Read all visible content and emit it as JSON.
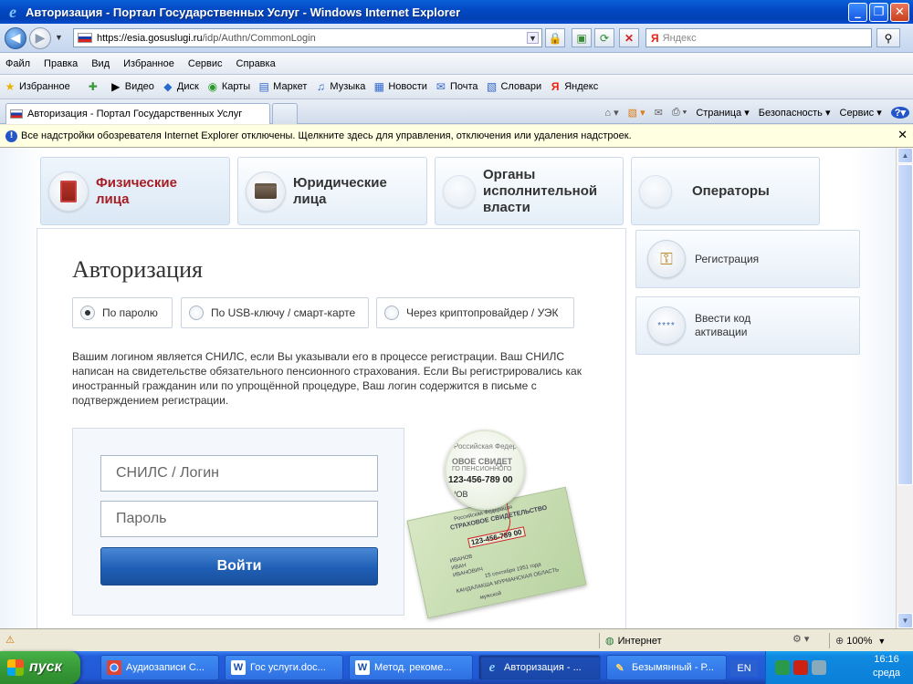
{
  "window": {
    "title": "Авторизация - Портал Государственных Услуг - Windows Internet Explorer",
    "ie_glyph": "e"
  },
  "navigation": {
    "url_scheme": "https://",
    "url_host": "esia.gosuslugi.ru",
    "url_path": "/idp/Authn/CommonLogin",
    "search_placeholder": "Яндекс",
    "search_brand": "Я"
  },
  "menu": [
    "Файл",
    "Правка",
    "Вид",
    "Избранное",
    "Сервис",
    "Справка"
  ],
  "favorites": [
    {
      "icon": "star-icon",
      "label": "Избранное",
      "glyph": "★"
    },
    {
      "icon": "add-favorite-icon",
      "label": "",
      "glyph": "✚"
    },
    {
      "icon": "video-icon",
      "label": "Видео",
      "glyph": "▶"
    },
    {
      "icon": "disk-icon",
      "label": "Диск",
      "glyph": "◆"
    },
    {
      "icon": "maps-icon",
      "label": "Карты",
      "glyph": "◉"
    },
    {
      "icon": "market-icon",
      "label": "Маркет",
      "glyph": "▤"
    },
    {
      "icon": "music-icon",
      "label": "Музыка",
      "glyph": "♫"
    },
    {
      "icon": "news-icon",
      "label": "Новости",
      "glyph": "▦"
    },
    {
      "icon": "mail-icon",
      "label": "Почта",
      "glyph": "✉"
    },
    {
      "icon": "dictionary-icon",
      "label": "Словари",
      "glyph": "▧"
    },
    {
      "icon": "yandex-icon",
      "label": "Яндекс",
      "glyph": "Я"
    }
  ],
  "tab": {
    "title": "Авторизация - Портал Государственных Услуг"
  },
  "commands": {
    "page": "Страница ▾",
    "security": "Безопасность ▾",
    "service": "Сервис ▾",
    "help": "?▾"
  },
  "infobar": {
    "text": "Все надстройки обозревателя Internet Explorer отключены. Щелкните здесь для управления, отключения или удаления надстроек.",
    "shield_glyph": "!"
  },
  "portal": {
    "tabs": [
      {
        "label_line1": "Физические",
        "label_line2": "лица",
        "label_line3": ""
      },
      {
        "label_line1": "Юридические",
        "label_line2": "лица",
        "label_line3": ""
      },
      {
        "label_line1": "Органы",
        "label_line2": "исполнительной",
        "label_line3": "власти"
      },
      {
        "label_line1": "Операторы",
        "label_line2": "",
        "label_line3": ""
      }
    ],
    "title": "Авторизация",
    "methods": [
      "По паролю",
      "По USB-ключу / смарт-карте",
      "Через криптопровайдер / УЭК"
    ],
    "description": "Вашим логином является СНИЛС, если Вы указывали его в процессе регистрации. Ваш СНИЛС написан на свидетельстве обязательного пенсионного страхования. Если Вы регистрировались как иностранный гражданин или по упрощённой процедуре, Ваш логин содержится в письме с подтверждением регистрации.",
    "login_placeholder": "СНИЛС / Логин",
    "password_placeholder": "Пароль",
    "login_button": "Войти",
    "card": {
      "line1": "Российская Федерация",
      "line2": "СТРАХОВОЕ СВИДЕТЕЛЬСТВО",
      "number": "123-456-789 00",
      "surname": "ИВАНОВ",
      "name": "ИВАН",
      "patronymic": "ИВАНОВИЧ",
      "birth_date": "15 сентября 1951 года",
      "place": "КАНДАЛАКША МУРМАНСКАЯ ОБЛАСТЬ",
      "sex": "мужской",
      "magnified_top": "Российская Федер",
      "magnified_title": "ОВОЕ СВИДЕТ",
      "magnified_sub": "ГО ПЕНСИОННОГО",
      "magnified_number": "123-456-789 00",
      "magnified_fragment": "НОВ"
    },
    "side_buttons": [
      {
        "label": "Регистрация",
        "icon": "keys-icon",
        "glyph": "🔑"
      },
      {
        "label": "Ввести код активации",
        "icon": "stars-icon",
        "glyph": "****"
      }
    ]
  },
  "status": {
    "zone": "Интернет",
    "zoom": "100%",
    "warn_glyph": "⚠"
  },
  "taskbar": {
    "start": "пуск",
    "items": [
      {
        "label": "Аудиозаписи С...",
        "icon": "chrome-icon",
        "glyph": "◉"
      },
      {
        "label": "Гос услуги.doc...",
        "icon": "word-icon",
        "glyph": "W"
      },
      {
        "label": "Метод. рекоме...",
        "icon": "word-icon",
        "glyph": "W"
      },
      {
        "label": "Авторизация - ...",
        "icon": "ie-icon",
        "glyph": "e"
      },
      {
        "label": "Безымянный - Р...",
        "icon": "paint-icon",
        "glyph": "✎"
      }
    ],
    "lang": "EN",
    "time": "16:16",
    "day": "среда"
  }
}
